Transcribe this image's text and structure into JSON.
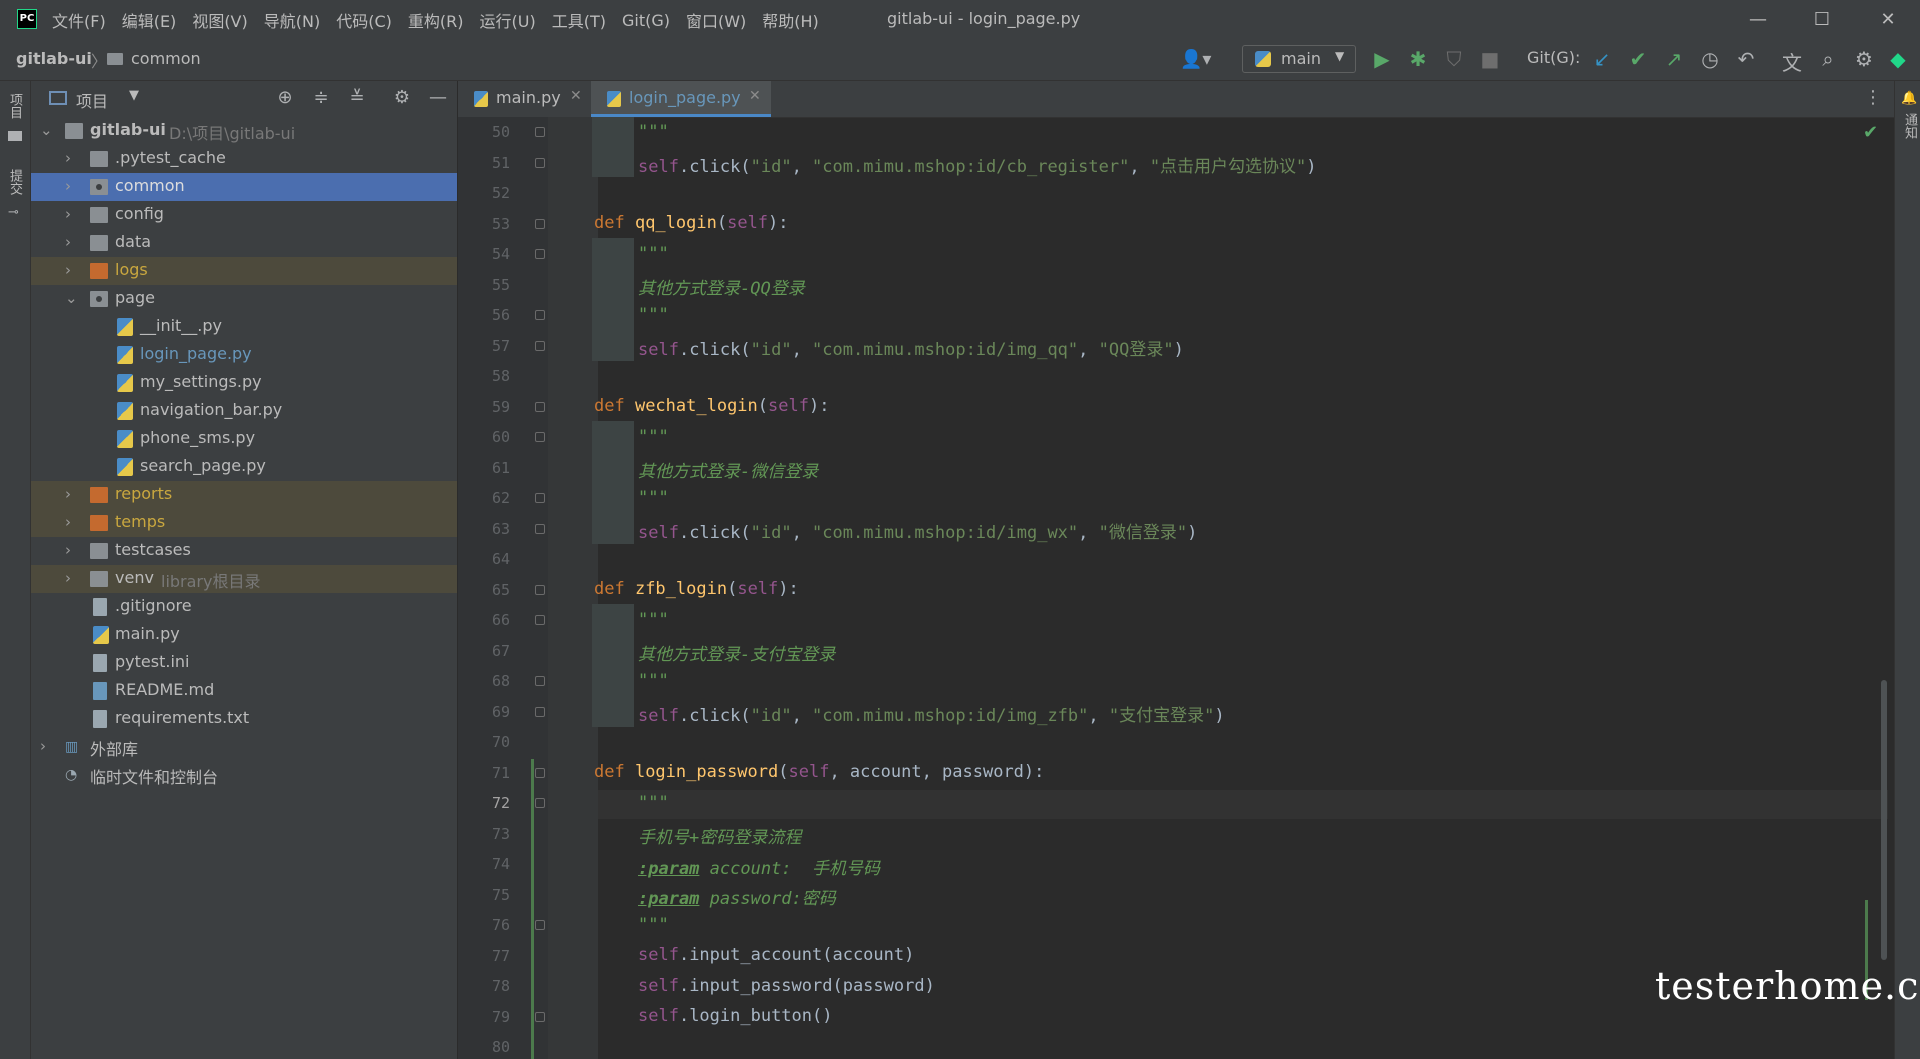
{
  "app": {
    "menu": [
      "文件(F)",
      "编辑(E)",
      "视图(V)",
      "导航(N)",
      "代码(C)",
      "重构(R)",
      "运行(U)",
      "工具(T)",
      "Git(G)",
      "窗口(W)",
      "帮助(H)"
    ],
    "window_title": "gitlab-ui - login_page.py",
    "window_controls": {
      "minimize": "—",
      "maximize": "☐",
      "close": "✕"
    },
    "logo_text": "PC"
  },
  "navbar": {
    "root": "gitlab-ui",
    "separator": "〉",
    "leaf": "common",
    "branch": "main",
    "git_label": "Git(G):"
  },
  "left_strip": {
    "project_tab": "项目",
    "commit_tab": "提交"
  },
  "right_strip": {
    "notifications_tab": "通知"
  },
  "project_panel": {
    "title": "项目",
    "tree": [
      {
        "label": "gitlab-ui",
        "hint": "D:\\项目\\gitlab-ui",
        "kind": "folder",
        "arrow": "⌄"
      },
      {
        "label": ".pytest_cache",
        "kind": "folder",
        "arrow": "›"
      },
      {
        "label": "common",
        "kind": "folder",
        "arrow": "›"
      },
      {
        "label": "config",
        "kind": "folder",
        "arrow": "›"
      },
      {
        "label": "data",
        "kind": "folder",
        "arrow": "›"
      },
      {
        "label": "logs",
        "kind": "folder",
        "arrow": "›"
      },
      {
        "label": "page",
        "kind": "folder",
        "arrow": "⌄"
      },
      {
        "label": "__init__.py",
        "kind": "py"
      },
      {
        "label": "login_page.py",
        "kind": "py"
      },
      {
        "label": "my_settings.py",
        "kind": "py"
      },
      {
        "label": "navigation_bar.py",
        "kind": "py"
      },
      {
        "label": "phone_sms.py",
        "kind": "py"
      },
      {
        "label": "search_page.py",
        "kind": "py"
      },
      {
        "label": "reports",
        "kind": "folder",
        "arrow": "›"
      },
      {
        "label": "temps",
        "kind": "folder",
        "arrow": "›"
      },
      {
        "label": "testcases",
        "kind": "folder",
        "arrow": "›"
      },
      {
        "label": "venv",
        "hint": "library根目录",
        "kind": "folder",
        "arrow": "›"
      },
      {
        "label": ".gitignore",
        "kind": "file"
      },
      {
        "label": "main.py",
        "kind": "py"
      },
      {
        "label": "pytest.ini",
        "kind": "file"
      },
      {
        "label": "README.md",
        "kind": "file"
      },
      {
        "label": "requirements.txt",
        "kind": "file"
      },
      {
        "label": "外部库",
        "kind": "lib",
        "arrow": "›"
      },
      {
        "label": "临时文件和控制台",
        "kind": "scratch"
      }
    ]
  },
  "editor": {
    "tabs": [
      {
        "label": "main.py",
        "close": "✕"
      },
      {
        "label": "login_page.py",
        "close": "✕"
      }
    ],
    "line_numbers": [
      "50",
      "51",
      "52",
      "53",
      "54",
      "55",
      "56",
      "57",
      "58",
      "59",
      "60",
      "61",
      "62",
      "63",
      "64",
      "65",
      "66",
      "67",
      "68",
      "69",
      "70",
      "71",
      "72",
      "73",
      "74",
      "75",
      "76",
      "77",
      "78",
      "79",
      "80"
    ],
    "current_line": "72",
    "lines": {
      "l50_doc": "\"\"\"",
      "l51_self": "self",
      "l51_call": ".click(",
      "l51_s1": "\"id\"",
      "l51_c1": ", ",
      "l51_s2": "\"com.mimu.mshop:id/cb_register\"",
      "l51_c2": ", ",
      "l51_s3": "\"点击用户勾选协议\"",
      "l51_end": ")",
      "l53_def": "def ",
      "l53_fn": "qq_login",
      "l53_p": "(",
      "l53_self": "self",
      "l53_e": "):",
      "l54_doc": "\"\"\"",
      "l55_doc": "其他方式登录-QQ登录",
      "l56_doc": "\"\"\"",
      "l57_self": "self",
      "l57_call": ".click(",
      "l57_s1": "\"id\"",
      "l57_c1": ", ",
      "l57_s2": "\"com.mimu.mshop:id/img_qq\"",
      "l57_c2": ", ",
      "l57_s3": "\"QQ登录\"",
      "l57_end": ")",
      "l59_def": "def ",
      "l59_fn": "wechat_login",
      "l59_p": "(",
      "l59_self": "self",
      "l59_e": "):",
      "l60_doc": "\"\"\"",
      "l61_doc": "其他方式登录-微信登录",
      "l62_doc": "\"\"\"",
      "l63_self": "self",
      "l63_call": ".click(",
      "l63_s1": "\"id\"",
      "l63_c1": ", ",
      "l63_s2": "\"com.mimu.mshop:id/img_wx\"",
      "l63_c2": ", ",
      "l63_s3": "\"微信登录\"",
      "l63_end": ")",
      "l65_def": "def ",
      "l65_fn": "zfb_login",
      "l65_p": "(",
      "l65_self": "self",
      "l65_e": "):",
      "l66_doc": "\"\"\"",
      "l67_doc": "其他方式登录-支付宝登录",
      "l68_doc": "\"\"\"",
      "l69_self": "self",
      "l69_call": ".click(",
      "l69_s1": "\"id\"",
      "l69_c1": ", ",
      "l69_s2": "\"com.mimu.mshop:id/img_zfb\"",
      "l69_c2": ", ",
      "l69_s3": "\"支付宝登录\"",
      "l69_end": ")",
      "l71_def": "def ",
      "l71_fn": "login_password",
      "l71_p": "(",
      "l71_self": "self",
      "l71_args": ", account, password",
      "l71_e": "):",
      "l72_doc": "\"\"\"",
      "l73_doc": "手机号+密码登录流程",
      "l74_param": ":param",
      "l74_doc": " account:  手机号码",
      "l75_param": ":param",
      "l75_doc": " password:密码",
      "l76_doc": "\"\"\"",
      "l77_self": "self",
      "l77_rest": ".input_account(account)",
      "l78_self": "self",
      "l78_rest": ".input_password(password)",
      "l79_self": "self",
      "l79_rest": ".login_button()"
    }
  },
  "watermark": "testerhome.com",
  "colors": {
    "keyword": "#cc7832",
    "function": "#ffc66d",
    "self": "#94558d",
    "string": "#6a8759",
    "docstring": "#629755",
    "selection": "#4b6eaf"
  }
}
